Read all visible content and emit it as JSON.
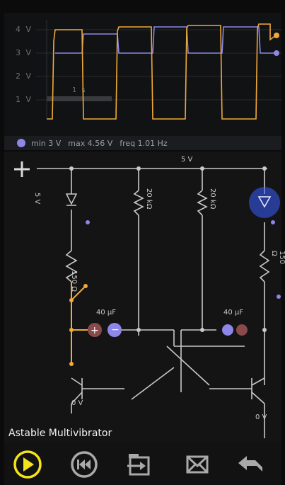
{
  "scope": {
    "voltage_labels": [
      "4 V",
      "3 V",
      "2 V",
      "1 V"
    ],
    "time_label": "1 s",
    "colors": {
      "orange": "#f0a93a",
      "violet": "#8e86e8"
    }
  },
  "info": {
    "min": "min  3 V",
    "max": "max  4.56 V",
    "freq": "freq  1.01 Hz"
  },
  "circuit": {
    "supply": "5 V",
    "resistor_left": "150 Ω",
    "resistor_mid1": "20 kΩ",
    "resistor_mid2": "20 kΩ",
    "resistor_right": "150 Ω",
    "cap_left": "40 µF",
    "cap_right": "40 µF",
    "ground_left": "0 V",
    "ground_right": "0 V",
    "side_label": "5 V"
  },
  "title": "Astable Multivibrator",
  "toolbar": {
    "play": "play-icon",
    "rewind": "rewind-icon",
    "load": "load-icon",
    "mail": "mail-icon",
    "back": "back-icon"
  }
}
